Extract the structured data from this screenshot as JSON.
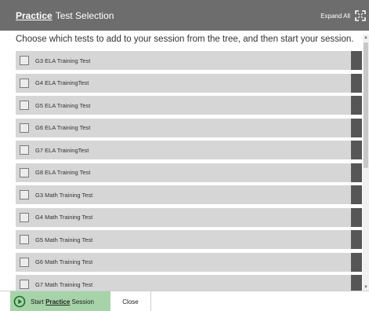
{
  "title_practice": "Practice",
  "title_rest": "Test Selection",
  "expand_all_label": "Expand All",
  "instructions": "Choose which tests to add to your session from the tree, and then start your session.",
  "tests": [
    {
      "label": "G3 ELA Training Test",
      "checked": false
    },
    {
      "label": "G4 ELA TrainingTest",
      "checked": false
    },
    {
      "label": "G5 ELA Training Test",
      "checked": false
    },
    {
      "label": "G6 ELA Training Test",
      "checked": false
    },
    {
      "label": "G7 ELA TrainingTest",
      "checked": false
    },
    {
      "label": "G8 ELA Training Test",
      "checked": false
    },
    {
      "label": "G3 Math Training Test",
      "checked": false
    },
    {
      "label": "G4 Math Training Test",
      "checked": false
    },
    {
      "label": "G5 Math Training Test",
      "checked": false
    },
    {
      "label": "G6 Math Training Test",
      "checked": false
    },
    {
      "label": "G7 Math Training Test",
      "checked": false
    }
  ],
  "footer": {
    "start_prefix": "Start",
    "start_practice": "Practice",
    "start_suffix": "Session",
    "close_label": "Close"
  },
  "colors": {
    "titlebar": "#6d6d6d",
    "row": "#d6d6d6",
    "row_handle": "#565656",
    "start_button": "#a6d4a8",
    "play_icon": "#1e6b2e"
  },
  "icons": {
    "expand": "expand-arrows-icon",
    "start": "play-circle-icon"
  }
}
